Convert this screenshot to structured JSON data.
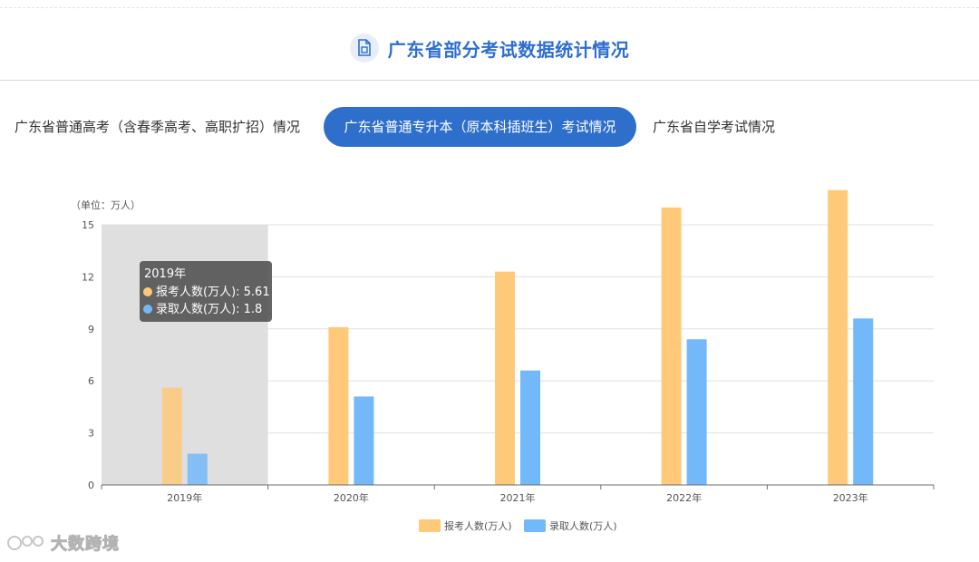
{
  "page": {
    "title": "广东省部分考试数据统计情况",
    "title_icon": "document-chart-icon",
    "accent_color": "#2e6fcc"
  },
  "tabs": [
    {
      "label": "广东省普通高考（含春季高考、高职扩招）情况",
      "active": false
    },
    {
      "label": "广东省普通专升本（原本科插班生）考试情况",
      "active": true
    },
    {
      "label": "广东省自学考试情况",
      "active": false
    }
  ],
  "chart_data": {
    "type": "bar",
    "unit_label": "（单位：万人）",
    "categories": [
      "2019年",
      "2020年",
      "2021年",
      "2022年",
      "2023年"
    ],
    "series": [
      {
        "name": "报考人数(万人)",
        "color": "#ffc97a",
        "values": [
          5.61,
          9.1,
          12.3,
          16.0,
          17.0
        ]
      },
      {
        "name": "录取人数(万人)",
        "color": "#73b9f9",
        "values": [
          1.8,
          5.1,
          6.6,
          8.4,
          9.6
        ]
      }
    ],
    "ylim": [
      0,
      15
    ],
    "yticks": [
      0,
      3,
      6,
      9,
      12,
      15
    ],
    "grid": true,
    "legend_position": "bottom-center",
    "highlighted_category": "2019年",
    "tooltip": {
      "title": "2019年",
      "rows": [
        "报考人数(万人): 5.61",
        "录取人数(万人): 1.8"
      ]
    }
  },
  "watermark": {
    "text": "大数跨境",
    "icon": "brand-logo-icon"
  }
}
